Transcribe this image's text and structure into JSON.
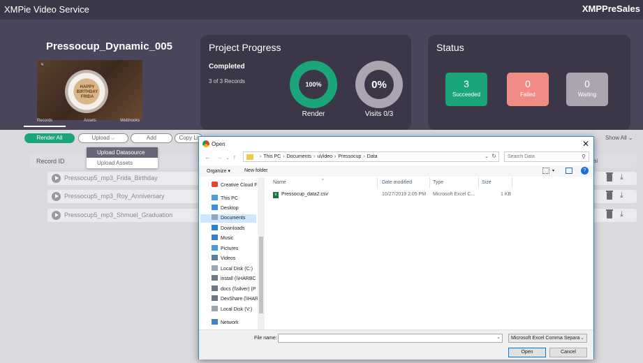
{
  "app": {
    "title": "XMPie Video Service",
    "account": "XMPPreSales"
  },
  "project": {
    "name": "Pressocup_Dynamic_005",
    "thumb_text": "HAPPY BIRTHDAY FRIDA"
  },
  "progress": {
    "title": "Project Progress",
    "completed_label": "Completed",
    "records_count": "3 of 3 Records",
    "render_value": "100%",
    "render_fraction": 1.0,
    "render_label": "Render",
    "visits_value": "0%",
    "visits_fraction": 0.0,
    "visits_label": "Visits 0/3"
  },
  "status": {
    "title": "Status",
    "succeeded": {
      "count": "3",
      "label": "Succeeded",
      "color": "#1aa57a"
    },
    "failed": {
      "count": "0",
      "label": "Failed",
      "color": "#f28b86"
    },
    "waiting": {
      "count": "0",
      "label": "Waiting",
      "color": "#aaa5b0"
    }
  },
  "tabs": [
    "Records",
    "Assets",
    "Webhooks"
  ],
  "toolbar": {
    "render_all": "Render All",
    "upload": "Upload",
    "add": "Add",
    "copy": "Copy Li",
    "show_all": "Show All"
  },
  "upload_menu": [
    "Upload Datasource",
    "Upload Assets"
  ],
  "records": {
    "column": "Record ID",
    "right_col": "ai",
    "rows": [
      "Pressocup5_mp3_Frida_Birthday",
      "Pressocup5_mp3_Roy_Anniversary",
      "Pressocup5_mp3_Shmuel_Graduation"
    ]
  },
  "dialog": {
    "title": "Open",
    "path": [
      "This PC",
      "Documents",
      "uVideo",
      "Pressocup",
      "Data"
    ],
    "search_placeholder": "Search Data",
    "organize": "Organize ▾",
    "new_folder": "New folder",
    "nav_items": [
      {
        "label": "Creative Cloud Fil",
        "icon": "creative-cloud-icon"
      },
      {
        "label": "This PC",
        "icon": "computer-icon"
      },
      {
        "label": "Desktop",
        "icon": "desktop-icon"
      },
      {
        "label": "Documents",
        "icon": "documents-icon",
        "selected": true
      },
      {
        "label": "Downloads",
        "icon": "download-icon"
      },
      {
        "label": "Music",
        "icon": "music-icon"
      },
      {
        "label": "Pictures",
        "icon": "pictures-icon"
      },
      {
        "label": "Videos",
        "icon": "videos-icon"
      },
      {
        "label": "Local Disk (C:)",
        "icon": "disk-icon"
      },
      {
        "label": "install (\\\\HARBC",
        "icon": "network-drive-icon"
      },
      {
        "label": "docs (\\\\silver) (P",
        "icon": "network-drive-icon"
      },
      {
        "label": "DevShare (\\\\HAR",
        "icon": "network-drive-icon"
      },
      {
        "label": "Local Disk (V:)",
        "icon": "disk-icon"
      },
      {
        "label": "Network",
        "icon": "network-icon"
      }
    ],
    "columns": {
      "name": "Name",
      "date": "Date modified",
      "type": "Type",
      "size": "Size"
    },
    "files": [
      {
        "name": "Pressocup_data2.csv",
        "date": "10/27/2019 2:05 PM",
        "type": "Microsoft Excel C...",
        "size": "1 KB"
      }
    ],
    "file_name_label": "File name:",
    "file_name_value": "",
    "file_type": "Microsoft Excel Comma Separa",
    "open_label": "Open",
    "cancel_label": "Cancel"
  }
}
